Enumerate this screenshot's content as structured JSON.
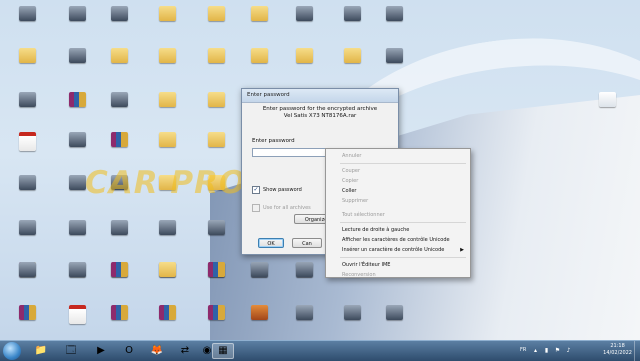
{
  "desktop": {
    "icons": [
      {
        "label": "",
        "kind": "app"
      },
      {
        "label": "",
        "kind": "app"
      },
      {
        "label": "",
        "kind": "app"
      },
      {
        "label": "",
        "kind": "folder"
      },
      {
        "label": "",
        "kind": "folder"
      },
      {
        "label": "",
        "kind": "folder"
      },
      {
        "label": "",
        "kind": "app"
      },
      {
        "label": "",
        "kind": "app"
      },
      {
        "label": "",
        "kind": "app"
      },
      {
        "label": "",
        "kind": "folder"
      },
      {
        "label": "",
        "kind": "app"
      },
      {
        "label": "",
        "kind": "folder"
      },
      {
        "label": "",
        "kind": "folder"
      },
      {
        "label": "",
        "kind": "folder"
      },
      {
        "label": "",
        "kind": "folder"
      },
      {
        "label": "",
        "kind": "folder"
      },
      {
        "label": "",
        "kind": "folder"
      },
      {
        "label": "",
        "kind": "app"
      },
      {
        "label": "",
        "kind": "app"
      },
      {
        "label": "",
        "kind": "rar"
      },
      {
        "label": "",
        "kind": "app"
      },
      {
        "label": "",
        "kind": "folder"
      },
      {
        "label": "",
        "kind": "folder"
      },
      {
        "label": "",
        "kind": "app"
      },
      {
        "label": "",
        "kind": "doc"
      },
      {
        "label": "",
        "kind": "pdf"
      },
      {
        "label": "",
        "kind": "app"
      },
      {
        "label": "",
        "kind": "rar"
      },
      {
        "label": "",
        "kind": "folder"
      },
      {
        "label": "",
        "kind": "folder"
      },
      {
        "label": "",
        "kind": "pdf"
      },
      {
        "label": "",
        "kind": "app"
      },
      {
        "label": "",
        "kind": "app"
      },
      {
        "label": "",
        "kind": "app"
      },
      {
        "label": "",
        "kind": "folder"
      },
      {
        "label": "",
        "kind": "folder"
      },
      {
        "label": "",
        "kind": "app"
      },
      {
        "label": "",
        "kind": "app"
      },
      {
        "label": "",
        "kind": "app"
      },
      {
        "label": "",
        "kind": "app"
      },
      {
        "label": "",
        "kind": "app"
      },
      {
        "label": "",
        "kind": "rar"
      },
      {
        "label": "",
        "kind": "app"
      },
      {
        "label": "",
        "kind": "app"
      },
      {
        "label": "",
        "kind": "app"
      },
      {
        "label": "",
        "kind": "rar"
      },
      {
        "label": "",
        "kind": "app"
      },
      {
        "label": "",
        "kind": "app"
      },
      {
        "label": "",
        "kind": "app"
      },
      {
        "label": "",
        "kind": "app"
      },
      {
        "label": "",
        "kind": "rar"
      },
      {
        "label": "",
        "kind": "folder"
      },
      {
        "label": "",
        "kind": "rar"
      },
      {
        "label": "",
        "kind": "app"
      },
      {
        "label": "",
        "kind": "app"
      },
      {
        "label": "",
        "kind": "app"
      },
      {
        "label": "",
        "kind": "rar"
      },
      {
        "label": "",
        "kind": "pdf"
      },
      {
        "label": "",
        "kind": "rar"
      },
      {
        "label": "",
        "kind": "rar"
      },
      {
        "label": "",
        "kind": "rar"
      },
      {
        "label": "",
        "kind": "media"
      },
      {
        "label": "",
        "kind": "app"
      },
      {
        "label": "",
        "kind": "app"
      },
      {
        "label": "",
        "kind": "app"
      }
    ]
  },
  "watermark": "CAR PROGRAMMING",
  "dialog": {
    "title": "Enter password",
    "message_line1": "Enter password for the encrypted archive",
    "message_line2": "Vel Satis X73 NT8176A.rar",
    "field_label": "Enter password",
    "show_password_label": "Show password",
    "show_password_checked": true,
    "use_all_label": "Use for all archives",
    "organize_label": "Organize pa",
    "ok_label": "OK",
    "cancel_label": "Can"
  },
  "context_menu": {
    "undo": "Annuler",
    "cut": "Couper",
    "copy": "Copier",
    "paste": "Coller",
    "delete": "Supprimer",
    "select_all": "Tout sélectionner",
    "rtl": "Lecture de droite à gauche",
    "show_unicode": "Afficher les caractères de contrôle Unicode",
    "insert_unicode": "Insérer un caractère de contrôle Unicode",
    "ime_open": "Ouvrir l'Éditeur IME",
    "reconvert": "Reconversion"
  },
  "taskbar": {
    "apps": [
      {
        "icon": "explorer-icon",
        "glyph": "📁",
        "active": false
      },
      {
        "icon": "window-icon",
        "glyph": "🗔",
        "active": false
      },
      {
        "icon": "media-player-icon",
        "glyph": "▶",
        "active": false
      },
      {
        "icon": "opera-icon",
        "glyph": "O",
        "active": false
      },
      {
        "icon": "firefox-icon",
        "glyph": "🦊",
        "active": false
      },
      {
        "icon": "teamviewer-icon",
        "glyph": "⇄",
        "active": false
      },
      {
        "icon": "chrome-icon",
        "glyph": "◉",
        "active": false
      },
      {
        "icon": "winrar-icon",
        "glyph": "▦",
        "active": true
      }
    ],
    "language": "FR",
    "time": "21:18",
    "date": "14/02/2022"
  }
}
